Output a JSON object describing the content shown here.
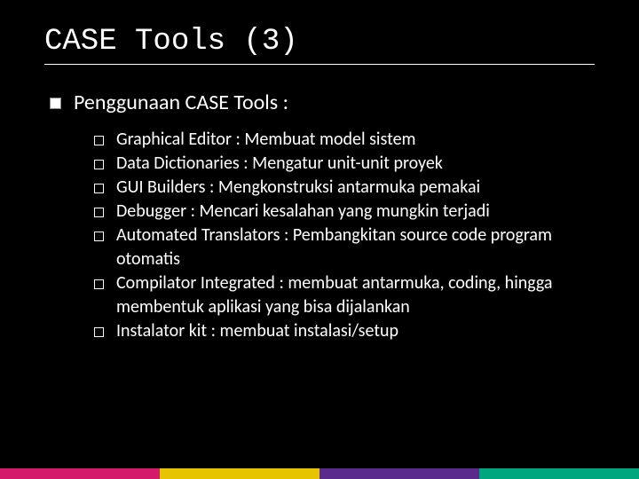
{
  "title": "CASE Tools (3)",
  "level1": "Penggunaan CASE Tools :",
  "items": [
    "Graphical Editor : Membuat model sistem",
    "Data Dictionaries : Mengatur unit-unit proyek",
    "GUI Builders : Mengkonstruksi antarmuka pemakai",
    "Debugger : Mencari kesalahan yang mungkin terjadi",
    "Automated Translators : Pembangkitan source code program otomatis",
    "Compilator Integrated : membuat antarmuka, coding, hingga membentuk aplikasi yang bisa dijalankan",
    "Instalator kit : membuat instalasi/setup"
  ]
}
